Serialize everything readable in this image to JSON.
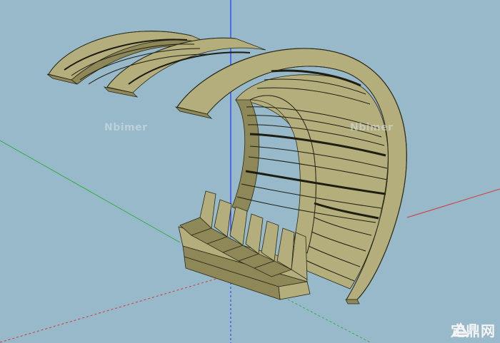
{
  "scene": {
    "background_color": "#97b9c9",
    "model_fill": "#b4ad7c",
    "model_fill_dark": "#8e8757",
    "slat_gap_color": "#1d1d12",
    "outline_color": "#2a2a18",
    "axis_blue": "#2434ff",
    "axis_red": "#d23a3a",
    "axis_green": "#2fb045"
  },
  "watermarks": {
    "left": "Nbimer",
    "right": "Nbimer",
    "color": "#d9e3e8"
  },
  "logo": {
    "icon": "zhulong-logo-icon",
    "text": "定鼎网",
    "color": "#f4f4f4"
  }
}
